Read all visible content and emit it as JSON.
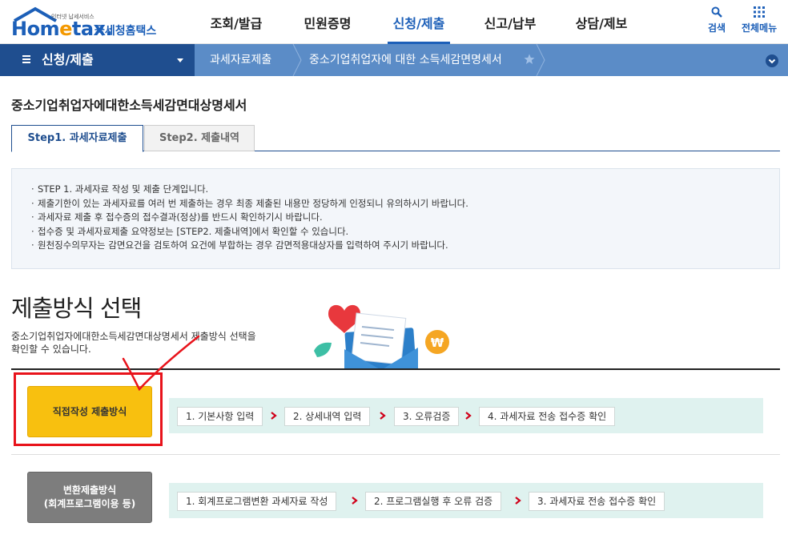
{
  "header": {
    "logo_sub": "인터넷 납세서비스",
    "logo_text_before": "Hom",
    "logo_text_accent": "e",
    "logo_text_after": "tax.",
    "logo_kor": "국세청홈택스",
    "gnb": [
      "조회/발급",
      "민원증명",
      "신청/제출",
      "신고/납부",
      "상담/제보"
    ],
    "gnb_active_index": 2,
    "search_label": "검색",
    "allmenu_label": "전체메뉴"
  },
  "nav": {
    "menu_label": "신청/제출",
    "crumb1": "과세자료제출",
    "crumb2": "중소기업취업자에 대한 소득세감면명세서"
  },
  "page": {
    "title": "중소기업취업자에대한소득세감면대상명세서",
    "tab_step1": "Step1. 과세자료제출",
    "tab_step2": "Step2. 제출내역"
  },
  "notice": [
    "STEP 1. 과세자료 작성 및 제출 단계입니다.",
    "제출기한이 있는 과세자료를 여러 번 제출하는 경우 최종 제출된 내용만 정당하게 인정되니 유의하시기 바랍니다.",
    "과세자료 제출 후 접수증의 접수결과(정상)를 반드시 확인하기시 바랍니다.",
    "접수증 및 과세자료제출 요약정보는 [STEP2. 제출내역]에서 확인할 수 있습니다.",
    "원천징수의무자는 감면요건을 검토하여 요건에 부합하는 경우 감면적용대상자를 입력하여 주시기 바랍니다."
  ],
  "section": {
    "title": "제출방식 선택",
    "desc_line1": "중소기업취업자에대한소득세감면대상명세서 제출방식 선택을",
    "desc_line2": "확인할 수 있습니다."
  },
  "direct": {
    "button_label": "직접작성 제출방식",
    "steps": [
      "1. 기본사항 입력",
      "2. 상세내역 입력",
      "3. 오류검증",
      "4. 과세자료 전송 접수증 확인"
    ]
  },
  "convert": {
    "button_line1": "변환제출방식",
    "button_line2": "(회계프로그램이용 등)",
    "steps": [
      "1. 회계프로그램변환 과세자료 작성",
      "2. 프로그램실행 후 오류 검증",
      "3. 과세자료 전송 접수증 확인"
    ]
  },
  "colors": {
    "brand_blue": "#1c5fb8",
    "nav_dark": "#1f4e8f",
    "nav_light": "#5b8cc7",
    "direct_button": "#f8c00f",
    "convert_button": "#7d7d7d",
    "steps_bg": "#dff2ef",
    "step_arrow": "#d0021b",
    "annotation_red": "#e8131b"
  }
}
